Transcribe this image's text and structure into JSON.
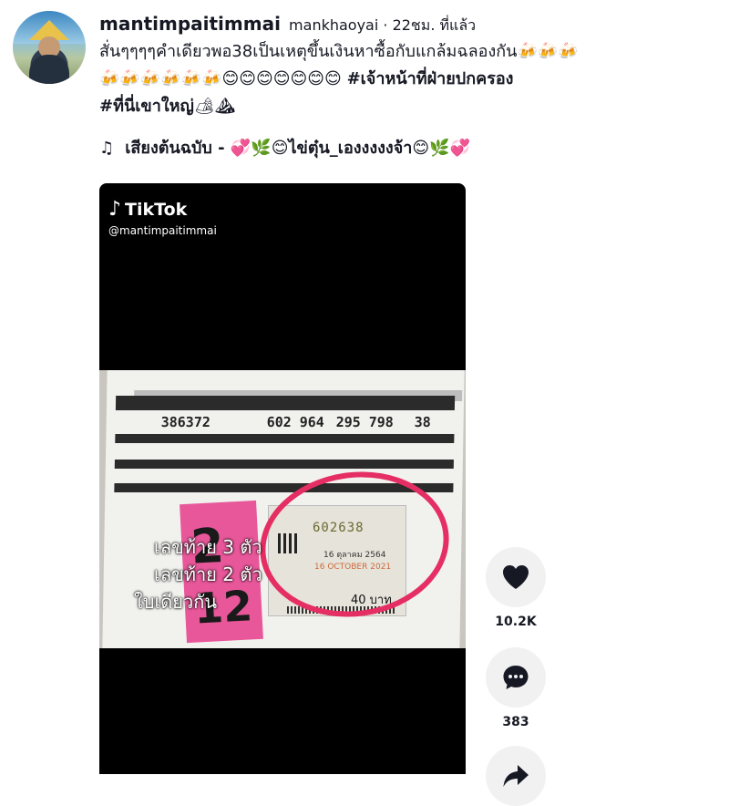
{
  "author": {
    "username": "mantimpaitimmai",
    "nickname": "mankhaoyai",
    "time": "22ชม. ที่แล้ว"
  },
  "description": {
    "line1": "สั่นๆๆๆๆคำเดียวพอ38เป็นเหตุขึ้นเงินหาซื้อกับแกล้มฉลองกัน🍻🍻🍻",
    "line2_emojis": "🍻🍻🍻🍻🍻🍻😊😊😊😊😊😊😊",
    "hashtag1": "#เจ้าหน้าที่ฝ่ายปกครอง",
    "hashtag2": "#ที่นี่เขาใหญ่",
    "hashtag2_emojis": "🏕⛰"
  },
  "music": {
    "icon": "♫",
    "text": "เสียงต้นฉบับ - 💞🌿😊ไข่ตุ๋น_เองงงงงจ้า😊🌿💞"
  },
  "video": {
    "watermark_logo": "TikTok",
    "watermark_handle": "@mantimpaitimmai",
    "overlay_text_line1": "เลขท้าย 3 ตัว",
    "overlay_text_line2": "เลขท้าย 2 ตัว",
    "overlay_text_line3": "ใบเดียวกัน",
    "ticket_number": "602638",
    "ticket_date_th": "16 ตุลาคม 2564",
    "ticket_date_en": "16 OCTOBER 2021",
    "ticket_price": "40 บาท",
    "pink_top": "2",
    "pink_bottom": "12",
    "result_first_prize": "386372",
    "result_front3": [
      "602",
      "964"
    ],
    "result_back3": [
      "295",
      "798"
    ],
    "result_back2": "38",
    "accent_color": "#e52e63"
  },
  "actions": {
    "likes": "10.2K",
    "comments": "383"
  }
}
